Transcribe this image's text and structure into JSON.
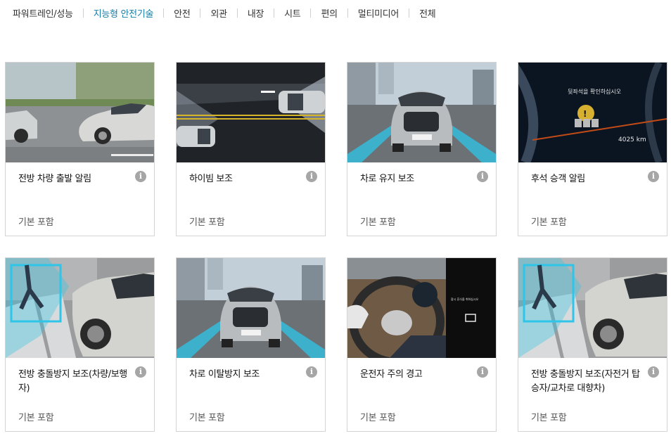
{
  "tabs": [
    {
      "label": "파워트레인/성능",
      "active": false
    },
    {
      "label": "지능형 안전기술",
      "active": true
    },
    {
      "label": "안전",
      "active": false
    },
    {
      "label": "외관",
      "active": false
    },
    {
      "label": "내장",
      "active": false
    },
    {
      "label": "시트",
      "active": false
    },
    {
      "label": "편의",
      "active": false
    },
    {
      "label": "멀티미디어",
      "active": false
    },
    {
      "label": "전체",
      "active": false
    }
  ],
  "info_icon_glyph": "i",
  "cards": [
    {
      "title": "전방 차량 출발 알림",
      "sub": "기본 포함",
      "image": "road-side-cars"
    },
    {
      "title": "하이빔 보조",
      "sub": "기본 포함",
      "image": "night-highbeam"
    },
    {
      "title": "차로 유지 보조",
      "sub": "기본 포함",
      "image": "front-car-lanes"
    },
    {
      "title": "후석 승객 알림",
      "sub": "기본 포함",
      "image": "cluster-rear-seat",
      "image_texts": [
        "뒷좌석을 확인하십시오",
        "4025 km"
      ]
    },
    {
      "title": "전방 충돌방지 보조(차량/보행자)",
      "sub": "기본 포함",
      "image": "pedestrian-crossing"
    },
    {
      "title": "차로 이탈방지 보조",
      "sub": "기본 포함",
      "image": "front-car-lanes"
    },
    {
      "title": "운전자 주의 경고",
      "sub": "기본 포함",
      "image": "steering-wheel",
      "image_texts": [
        "잠시 휴식을 취하십시오"
      ]
    },
    {
      "title": "전방 충돌방지 보조(자전거 탑승자/교차로 대향차)",
      "sub": "기본 포함",
      "image": "pedestrian-crossing"
    }
  ]
}
